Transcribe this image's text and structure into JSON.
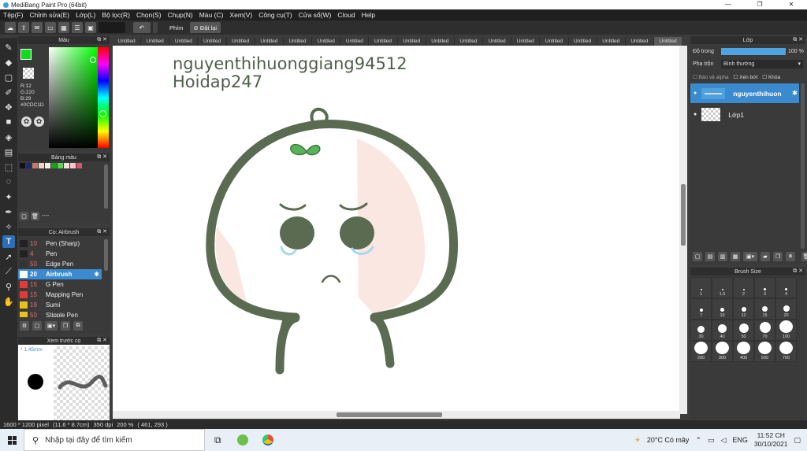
{
  "window": {
    "title": "MediBang Paint Pro (64bit)",
    "controls": [
      "—",
      "❐",
      "✕"
    ]
  },
  "menu": [
    "Tệp(F)",
    "Chỉnh sửa(E)",
    "Lớp(L)",
    "Bộ lọc(R)",
    "Chọn(S)",
    "Chụp(N)",
    "Màu (C)",
    "Xem(V)",
    "Công cụ(T)",
    "Cửa sổ(W)",
    "Cloud",
    "Help"
  ],
  "toolbar": {
    "key_label": "Phím",
    "reset_label": "Đặt lại"
  },
  "color_panel": {
    "title": "Màu",
    "r": "R:12",
    "g": "G:220",
    "b": "B:29",
    "hex": "#0CDC1D",
    "fg_color": "#0CDC1D"
  },
  "palette_panel": {
    "title": "Bảng màu",
    "footer": "----",
    "swatches": [
      "#111111",
      "#1c2a6e",
      "#c47a6a",
      "#f4d3c0",
      "#f6efe0",
      "#19a11a",
      "#63cf5b",
      "#f2e1dd",
      "#f4c6cf",
      "#d1586a"
    ]
  },
  "brush_panel": {
    "title": "Cọ: Airbrush",
    "items": [
      {
        "size": "10",
        "name": "Pen (Sharp)",
        "color": "#222222"
      },
      {
        "size": "4",
        "name": "Pen",
        "color": "#222222"
      },
      {
        "size": "50",
        "name": "Edge Pen",
        "color": "#333333"
      },
      {
        "size": "20",
        "name": "Airbrush",
        "color": "#ffffff"
      },
      {
        "size": "15",
        "name": "G Pen",
        "color": "#e23a3a"
      },
      {
        "size": "15",
        "name": "Mapping Pen",
        "color": "#e23a3a"
      },
      {
        "size": "19",
        "name": "Sumi",
        "color": "#e8c21a"
      },
      {
        "size": "50",
        "name": "Stipple Pen",
        "color": "#e8c21a"
      }
    ]
  },
  "preview_panel": {
    "title": "Xem trước cọ",
    "size_label": "1.45mm"
  },
  "tabs": [
    "Untitled",
    "Untitled",
    "Untitled",
    "Untitled",
    "Untitled",
    "Untitled",
    "Untitled",
    "Untitled",
    "Untitled",
    "Untitled",
    "Untitled",
    "Untitled",
    "Untitled",
    "Untitled",
    "Untitled",
    "Untitled",
    "Untitled",
    "Untitled",
    "Untitled",
    "Untitled"
  ],
  "canvas": {
    "line1": "nguyenthihuonggiang94512",
    "line2": "Hoidap247"
  },
  "layer_panel": {
    "title": "Lớp",
    "opacity_label": "Độ trong",
    "opacity_value": "100 %",
    "opacity": 1.0,
    "blend_label": "Pha trộn",
    "blend_value": "Bình thường",
    "protect_alpha": "Bảo vệ alpha",
    "clipping": "Xén bớt",
    "lock": "Khóa",
    "layers": [
      {
        "name": "nguyenthihuon",
        "selected": true
      },
      {
        "name": "Lớp1",
        "selected": false
      }
    ]
  },
  "brush_size_panel": {
    "title": "Brush Size",
    "sizes": [
      "1",
      "1.5",
      "2",
      "3",
      "4",
      "7",
      "10",
      "12",
      "15",
      "20",
      "30",
      "40",
      "50",
      "70",
      "100",
      "200",
      "300",
      "400",
      "500",
      "700"
    ]
  },
  "status": {
    "dimensions": "1600 * 1200 pixel",
    "physical": "(11.6 * 8.7cm)",
    "dpi": "350 dpi",
    "zoom": "200 %",
    "cursor": "( 461, 293 )"
  },
  "taskbar": {
    "search_placeholder": "Nhập tại đây để tìm kiếm",
    "weather": "20°C Có mây",
    "language": "ENG",
    "time": "11:52 CH",
    "date": "30/10/2021"
  }
}
